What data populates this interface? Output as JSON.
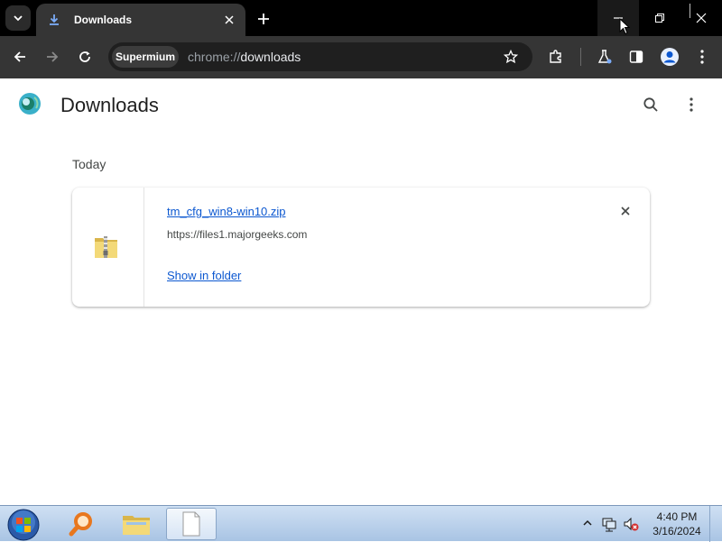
{
  "browser": {
    "tab": {
      "title": "Downloads",
      "icon": "download-icon"
    },
    "window_controls": [
      "minimize-icon",
      "restore-icon",
      "close-icon"
    ],
    "toolbar": {
      "site_chip": "Supermium",
      "url_scheme": "chrome://",
      "url_host": "downloads"
    }
  },
  "page": {
    "title": "Downloads",
    "date_group": "Today",
    "downloads": [
      {
        "file_name": "tm_cfg_win8-win10.zip",
        "source": "https://files1.majorgeeks.com",
        "action": "Show in folder",
        "icon": "zip-folder-icon"
      }
    ]
  },
  "taskbar": {
    "items": [
      "start-orb",
      "search-magnifier-app",
      "file-explorer",
      "blank-document"
    ],
    "clock": {
      "time": "4:40 PM",
      "date": "3/16/2024"
    }
  },
  "colors": {
    "link": "#0b57d0",
    "toolbar": "#353535",
    "titlebar": "#000000"
  }
}
